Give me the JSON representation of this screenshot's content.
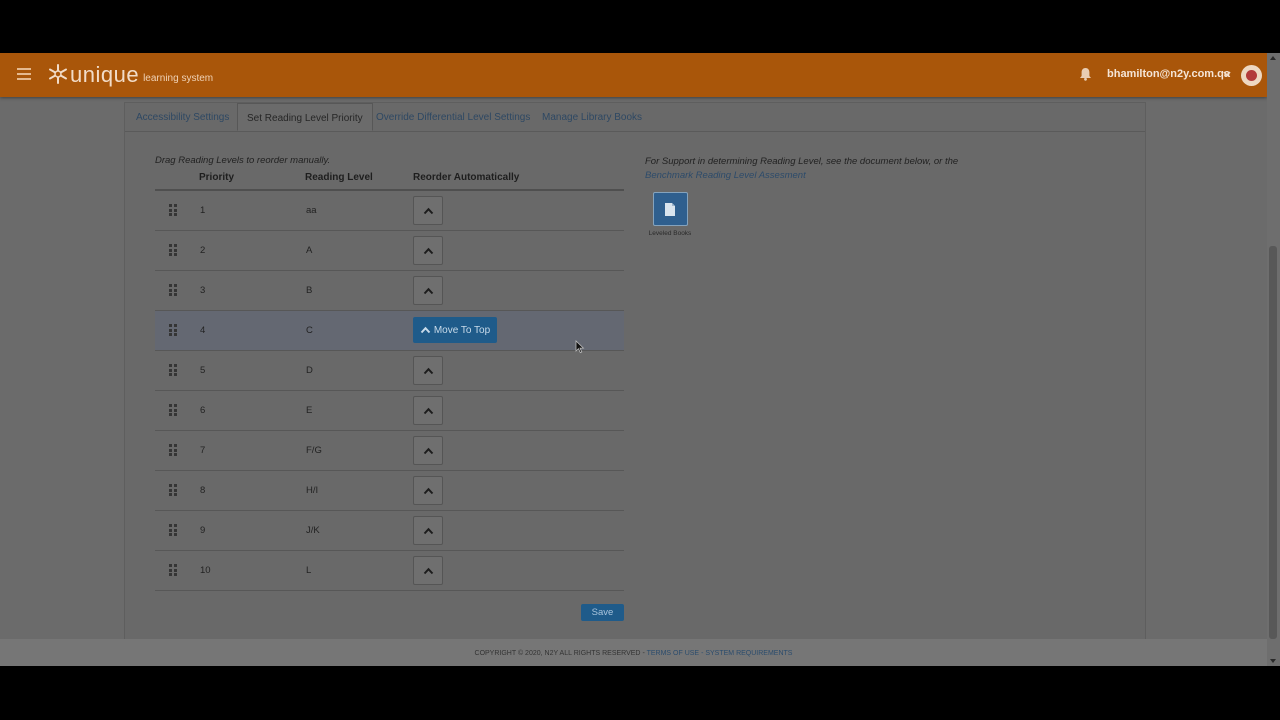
{
  "header": {
    "logo_text": "unique",
    "logo_sub": "learning system",
    "user_email": "bhamilton@n2y.com.qa",
    "icons": [
      "hamburger-icon",
      "snowflake-logo-icon",
      "bell-icon",
      "chevron-down-icon",
      "avatar-icon"
    ]
  },
  "tabs": [
    {
      "label": "Accessibility Settings",
      "active": false
    },
    {
      "label": "Set Reading Level Priority",
      "active": true
    },
    {
      "label": "Override Differential Level Settings",
      "active": false
    },
    {
      "label": "Manage Library Books",
      "active": false
    }
  ],
  "hint": "Drag Reading Levels to reorder manually.",
  "table": {
    "columns": [
      "Priority",
      "Reading Level",
      "Reorder Automatically"
    ],
    "rows": [
      {
        "priority": "1",
        "level": "aa"
      },
      {
        "priority": "2",
        "level": "A"
      },
      {
        "priority": "3",
        "level": "B"
      },
      {
        "priority": "4",
        "level": "C"
      },
      {
        "priority": "5",
        "level": "D"
      },
      {
        "priority": "6",
        "level": "E"
      },
      {
        "priority": "7",
        "level": "F/G"
      },
      {
        "priority": "8",
        "level": "H/I"
      },
      {
        "priority": "9",
        "level": "J/K"
      },
      {
        "priority": "10",
        "level": "L"
      }
    ],
    "move_to_top_label": "Move To Top",
    "highlighted_row": 4
  },
  "support": {
    "text": "For Support in determining Reading Level, see the document below, or the",
    "link": "Benchmark Reading Level Assesment",
    "doc_label": "Leveled Books"
  },
  "save_label": "Save",
  "footer": {
    "copyright": "COPYRIGHT © 2020, N2Y ALL RIGHTS RESERVED",
    "terms": "TERMS OF USE",
    "sep": " - ",
    "requirements": "SYSTEM REQUIREMENTS"
  },
  "colors": {
    "header": "#a9560a",
    "primary_button": "#1f5b8a",
    "overlay": "#6b6b6b"
  }
}
